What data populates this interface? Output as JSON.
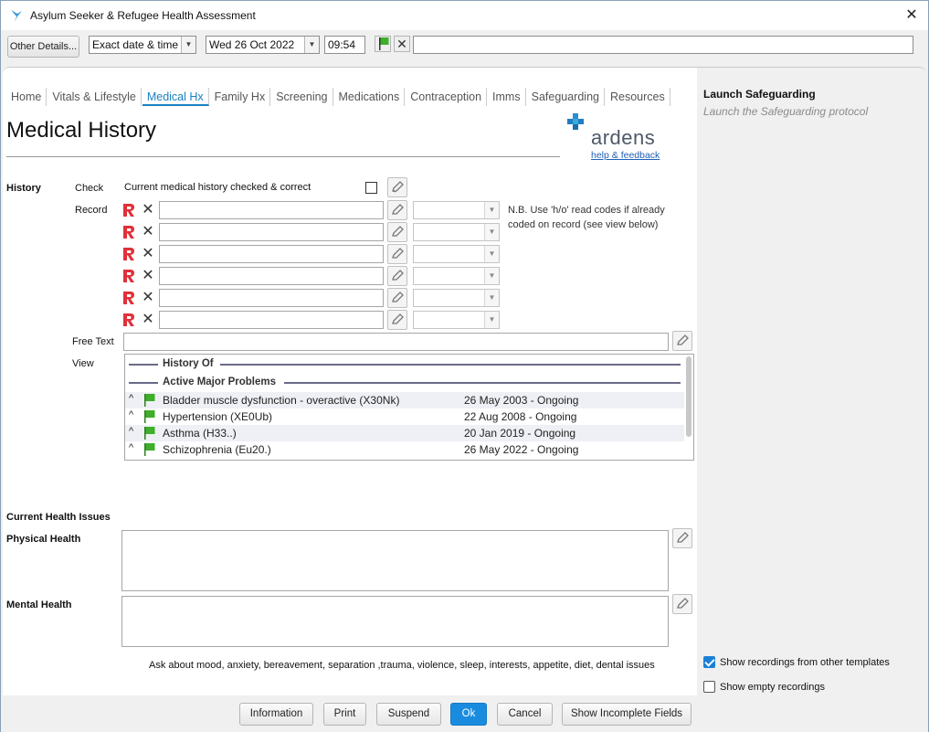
{
  "window": {
    "title": "Asylum Seeker & Refugee Health Assessment",
    "close": "✕"
  },
  "toolbar": {
    "other_details": "Other Details...",
    "date_mode": "Exact date & time",
    "date": "Wed 26 Oct 2022",
    "time": "09:54",
    "clear": "✕"
  },
  "tabs": [
    "Home",
    "Vitals & Lifestyle",
    "Medical Hx",
    "Family Hx",
    "Screening",
    "Medications",
    "Contraception",
    "Imms",
    "Safeguarding",
    "Resources"
  ],
  "active_tab": "Medical Hx",
  "page": {
    "title": "Medical History",
    "logo_text": "ardens",
    "help_link": "help & feedback"
  },
  "history": {
    "section_label": "History",
    "check_label": "Check",
    "check_text": "Current medical history checked & correct",
    "record_label": "Record",
    "note": "N.B. Use 'h/o' read codes if already coded on record (see view below)",
    "free_text_label": "Free Text",
    "view_label": "View"
  },
  "view": {
    "section1": "History Of",
    "section2": "Active Major Problems",
    "problems": [
      {
        "name": "Bladder muscle dysfunction - overactive (X30Nk)",
        "date": "26 May 2003 - Ongoing"
      },
      {
        "name": "Hypertension (XE0Ub)",
        "date": "22 Aug 2008 - Ongoing"
      },
      {
        "name": "Asthma (H33..)",
        "date": "20 Jan 2019 - Ongoing"
      },
      {
        "name": "Schizophrenia (Eu20.)",
        "date": "26 May 2022 - Ongoing"
      }
    ]
  },
  "current": {
    "section_label": "Current Health Issues",
    "physical_label": "Physical Health",
    "mental_label": "Mental Health",
    "hint": "Ask about mood, anxiety, bereavement, separation ,trauma, violence, sleep, interests, appetite, diet, dental issues"
  },
  "right": {
    "title": "Launch Safeguarding",
    "subtitle": "Launch the Safeguarding protocol",
    "show_other": "Show recordings from other templates",
    "show_empty": "Show empty recordings",
    "show_other_checked": true,
    "show_empty_checked": false
  },
  "footer": {
    "information": "Information",
    "print": "Print",
    "suspend": "Suspend",
    "ok": "Ok",
    "cancel": "Cancel",
    "show_incomplete": "Show Incomplete Fields"
  },
  "colors": {
    "accent": "#1a7fc1",
    "flag": "#3fae2a",
    "r_icon": "#e0303a"
  }
}
